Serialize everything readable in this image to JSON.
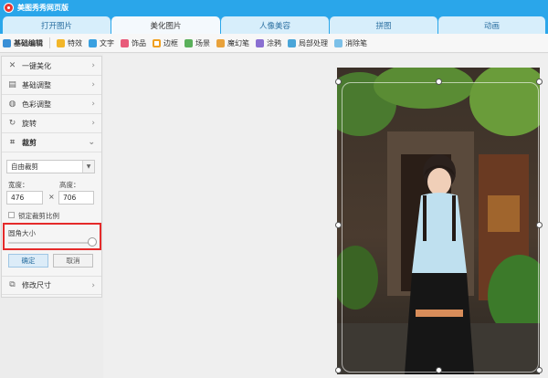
{
  "app": {
    "title": "美图秀秀网页版"
  },
  "tabs": [
    {
      "label": "打开图片",
      "active": false
    },
    {
      "label": "美化图片",
      "active": true
    },
    {
      "label": "人像美容",
      "active": false
    },
    {
      "label": "拼图",
      "active": false
    },
    {
      "label": "动画",
      "active": false
    }
  ],
  "toolbar": {
    "items": [
      {
        "label": "基础编辑",
        "icon": "edit-icon",
        "active": true
      },
      {
        "label": "特效",
        "icon": "magic-wand-icon"
      },
      {
        "label": "文字",
        "icon": "text-icon"
      },
      {
        "label": "饰品",
        "icon": "bow-icon"
      },
      {
        "label": "边框",
        "icon": "frame-icon"
      },
      {
        "label": "场景",
        "icon": "scene-icon"
      },
      {
        "label": "魔幻笔",
        "icon": "magic-pen-icon"
      },
      {
        "label": "涂鸦",
        "icon": "brush-icon"
      },
      {
        "label": "局部处理",
        "icon": "local-process-icon"
      },
      {
        "label": "消除笔",
        "icon": "eraser-icon"
      }
    ]
  },
  "sidebar": {
    "items": [
      {
        "label": "一键美化",
        "icon": "wand-icon"
      },
      {
        "label": "基础调整",
        "icon": "adjust-icon"
      },
      {
        "label": "色彩调整",
        "icon": "palette-icon"
      },
      {
        "label": "旋转",
        "icon": "rotate-icon"
      },
      {
        "label": "裁剪",
        "icon": "crop-icon",
        "open": true
      }
    ],
    "crop": {
      "mode_value": "自由裁剪",
      "width_label": "宽度：",
      "height_label": "高度：",
      "width_value": "476",
      "height_value": "706",
      "times": "×",
      "lock_ratio_label": "锁定裁剪比例",
      "round_corner_label": "圆角大小",
      "round_corner_value": 1.0,
      "ok_label": "确定",
      "cancel_label": "取消"
    },
    "resize_label": "修改尺寸"
  }
}
